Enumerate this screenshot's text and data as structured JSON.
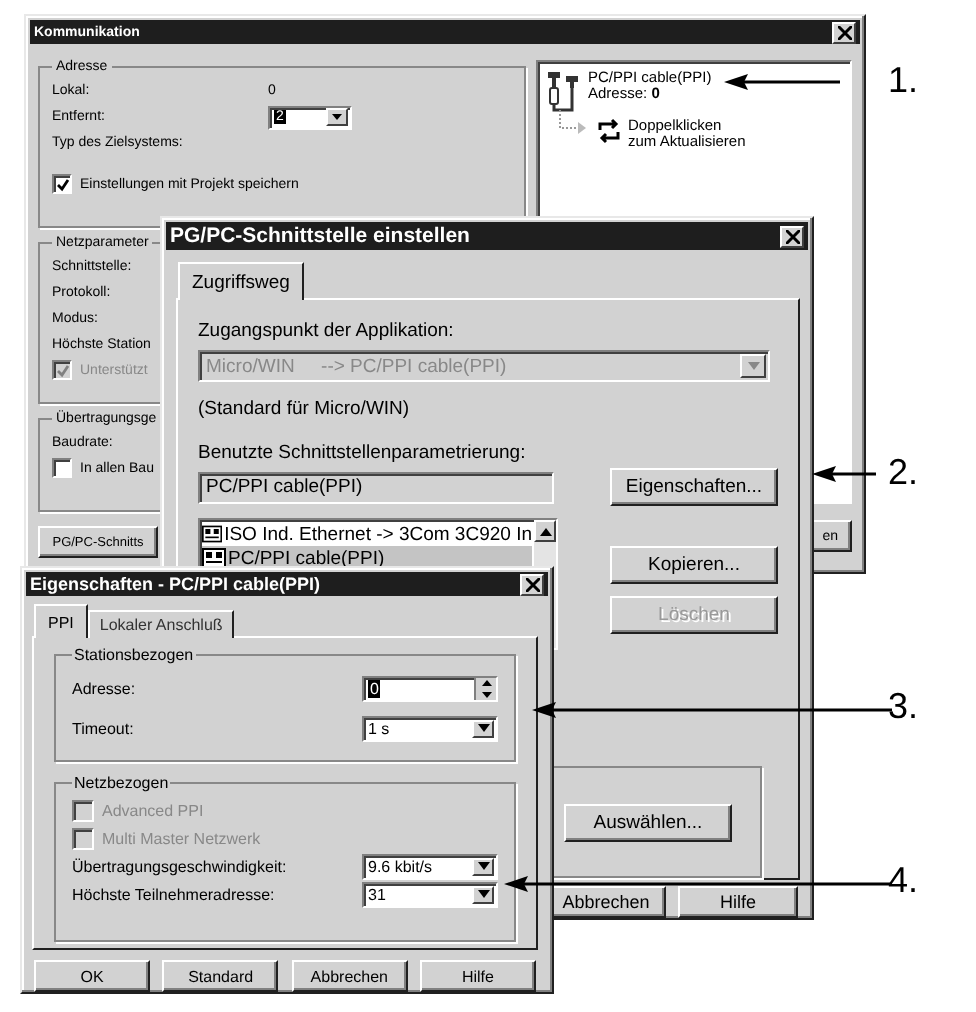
{
  "communication_window": {
    "title": "Kommunikation",
    "address_group": {
      "legend": "Adresse",
      "rows": [
        {
          "kind": "value",
          "label": "Lokal:",
          "value": "0"
        },
        {
          "kind": "dropdown",
          "label": "Entfernt:",
          "value": "2"
        },
        {
          "kind": "label",
          "label": "Typ des Zielsystems:"
        }
      ],
      "checkbox": {
        "label": "Einstellungen mit Projekt speichern",
        "checked": true,
        "disabled": false
      }
    },
    "network_group": {
      "legend": "Netzparameter",
      "labels": [
        "Schnittstelle:",
        "Protokoll:",
        "Modus:",
        "Höchste Station"
      ],
      "checkbox": {
        "label": "Unterstützt",
        "checked": true,
        "disabled": true
      }
    },
    "transfer_group": {
      "legend": "Übertragungsge",
      "labels": [
        "Baudrate:"
      ],
      "checkbox": {
        "label": "In allen Bau",
        "checked": false,
        "disabled": false
      }
    },
    "interface_button": "PG/PC-Schnitts",
    "tree": [
      {
        "kind": "cable",
        "title": "PC/PPI cable(PPI)",
        "subtitle": "Adresse: **0**"
      },
      {
        "kind": "refresh",
        "title": "Doppelklicken",
        "subtitle": "zum Aktualisieren"
      }
    ],
    "right_button": "en"
  },
  "interface_window": {
    "title": "PG/PC-Schnittstelle einstellen",
    "tabs": [
      {
        "label": "Zugriffsweg",
        "selected": true
      }
    ],
    "access_point_label": "Zugangspunkt der Applikation:",
    "access_point": {
      "value": "Micro/WIN     --> PC/PPI cable(PPI)",
      "disabled": true
    },
    "standard_note": "(Standard für Micro/WIN)",
    "parameter_label": "Benutzte Schnittstellenparametrierung:",
    "parameter_value": "PC/PPI cable(PPI)",
    "properties_button": "Eigenschaften...",
    "list": [
      {
        "label": "ISO Ind. Ethernet -> 3Com 3C920 In",
        "selected": false
      },
      {
        "label": "PC/PPI cable(PPI)",
        "selected": true
      }
    ],
    "side_buttons": [
      {
        "label": "Kopieren...",
        "disabled": false
      },
      {
        "label": "Löschen",
        "disabled": true
      }
    ],
    "select_button": "Auswählen...",
    "bottom_buttons": [
      "Abbrechen",
      "Hilfe"
    ]
  },
  "properties_window": {
    "title": "Eigenschaften - PC/PPI cable(PPI)",
    "tabs": [
      {
        "label": "PPI",
        "selected": true
      },
      {
        "label": "Lokaler Anschluß",
        "selected": false
      }
    ],
    "station_group": {
      "legend": "Stationsbezogen",
      "fields": [
        {
          "kind": "spin",
          "label": "Adresse:",
          "value": "0"
        },
        {
          "kind": "dropdown",
          "label": "Timeout:",
          "value": "1 s"
        }
      ]
    },
    "network_group": {
      "legend": "Netzbezogen",
      "checkboxes": [
        {
          "label": "Advanced PPI",
          "checked": false,
          "disabled": true
        },
        {
          "label": "Multi Master Netzwerk",
          "checked": false,
          "disabled": true
        }
      ],
      "fields": [
        {
          "kind": "dropdown",
          "label": "Übertragungsgeschwindigkeit:",
          "value": "9.6 kbit/s"
        },
        {
          "kind": "dropdown",
          "label": "Höchste Teilnehmeradresse:",
          "value": "31"
        }
      ]
    },
    "buttons": [
      "OK",
      "Standard",
      "Abbrechen",
      "Hilfe"
    ]
  },
  "callouts": [
    {
      "label": "1."
    },
    {
      "label": "2."
    },
    {
      "label": "3."
    },
    {
      "label": "4."
    }
  ]
}
